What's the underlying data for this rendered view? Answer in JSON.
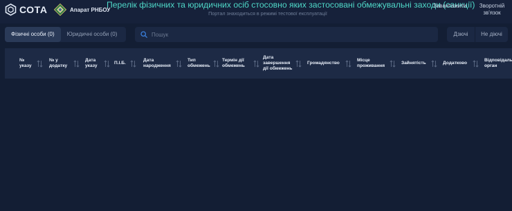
{
  "header": {
    "logo_text": "СОТА",
    "org_name": "Апарат РНБОУ",
    "title": "Перелік фізичних та юридичних осіб стосовно яких застосовані обмежувальні заходи (санкції)",
    "subtitle": "Портал знаходиться в режимі тестової експлуатації",
    "download_label": "Завантажити",
    "feedback_label": "Зворотній зв'язок"
  },
  "tabs": [
    {
      "label": "Фізичні особи (0)",
      "active": true
    },
    {
      "label": "Юридичні особи (0)",
      "active": false
    }
  ],
  "search": {
    "placeholder": "Пошук",
    "value": ""
  },
  "status_filter": {
    "valid_label": "Дзючі",
    "invalid_label": "Не діючі"
  },
  "table": {
    "columns": [
      "№ указу",
      "№ у додатку",
      "Дата указу",
      "П.І.Б.",
      "Дата народження",
      "Тип обмежень",
      "Термін дії обмежень",
      "Дата завершення дії обмежень",
      "Громадянство",
      "Місце проживання",
      "Зайнятість",
      "Додатково",
      "Відповідальний орган"
    ],
    "rows": []
  },
  "colors": {
    "background": "#131e34",
    "header_bg": "#16213a",
    "title_accent": "#4fd8c8",
    "table_header_bg": "#1d2a45",
    "search_icon": "#3b82e0"
  },
  "icons": [
    "sota-logo-icon",
    "emblem-icon",
    "search-icon",
    "sort-icon"
  ]
}
